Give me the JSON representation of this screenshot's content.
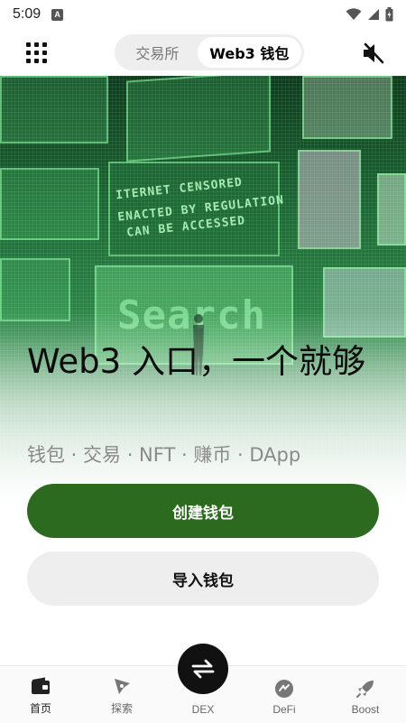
{
  "status_bar": {
    "time": "5:09",
    "notification_letter": "A"
  },
  "header": {
    "tabs": [
      {
        "label": "交易所",
        "active": false
      },
      {
        "label": "Web3 钱包",
        "active": true
      }
    ],
    "menu_icon": "grid-menu-icon",
    "sound_icon": "speaker-muted-icon"
  },
  "hero": {
    "title": "Web3 入口，一个就够",
    "subtitle": "钱包 · 交易 · NFT · 赚币 · DApp",
    "neon_lines": [
      "ITERNET CENSORED",
      "ENACTED BY REGULATION",
      "CAN BE ACCESSED"
    ],
    "neon_search": "Search"
  },
  "actions": {
    "create_wallet": "创建钱包",
    "import_wallet": "导入钱包"
  },
  "bottom_nav": {
    "items": [
      {
        "label": "首页",
        "icon": "wallet-icon"
      },
      {
        "label": "探索",
        "icon": "compass-icon"
      },
      {
        "label": "DEX",
        "icon": "swap-arrows-icon"
      },
      {
        "label": "DeFi",
        "icon": "defi-icon"
      },
      {
        "label": "Boost",
        "icon": "rocket-icon"
      }
    ]
  },
  "colors": {
    "primary": "#2c6b1f",
    "secondary_bg": "#eeeeee",
    "dex": "#111111"
  }
}
